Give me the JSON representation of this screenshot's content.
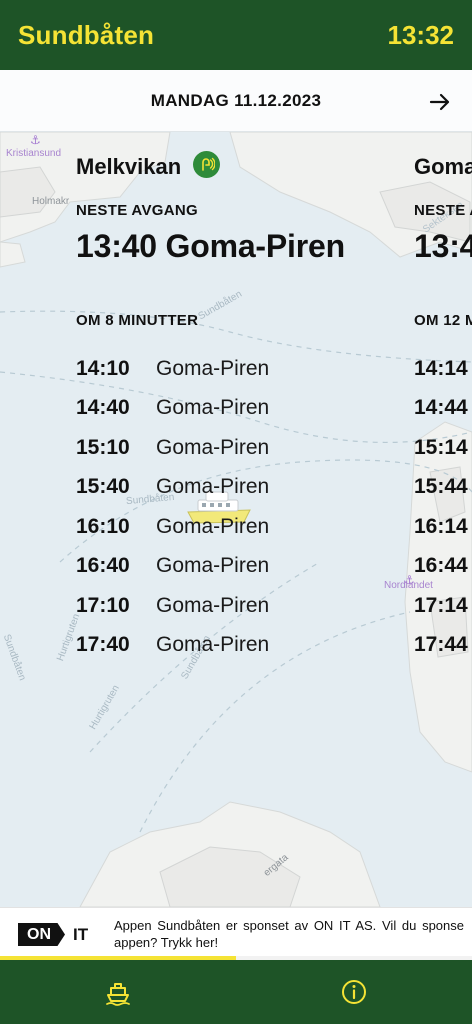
{
  "header": {
    "title": "Sundbåten",
    "time": "13:32"
  },
  "date_bar": {
    "date": "MANDAG 11.12.2023",
    "next_icon": "arrow-right-icon"
  },
  "panels": [
    {
      "stop": "Melkvikan",
      "realtime_icon": "realtime-icon",
      "next_label": "NESTE AVGANG",
      "next_departure": "13:40 Goma-Piren",
      "countdown": "OM 8 MINUTTER",
      "departures": [
        {
          "time": "14:10",
          "dest": "Goma-Piren"
        },
        {
          "time": "14:40",
          "dest": "Goma-Piren"
        },
        {
          "time": "15:10",
          "dest": "Goma-Piren"
        },
        {
          "time": "15:40",
          "dest": "Goma-Piren"
        },
        {
          "time": "16:10",
          "dest": "Goma-Piren"
        },
        {
          "time": "16:40",
          "dest": "Goma-Piren"
        },
        {
          "time": "17:10",
          "dest": "Goma-Piren"
        },
        {
          "time": "17:40",
          "dest": "Goma-Piren"
        }
      ]
    },
    {
      "stop": "Goma",
      "next_label": "NESTE A",
      "next_departure": "13:4",
      "countdown": "OM 12 M",
      "departures": [
        {
          "time": "14:14"
        },
        {
          "time": "14:44"
        },
        {
          "time": "15:14"
        },
        {
          "time": "15:44"
        },
        {
          "time": "16:14"
        },
        {
          "time": "16:44"
        },
        {
          "time": "17:14"
        },
        {
          "time": "17:44"
        }
      ]
    }
  ],
  "map_labels": {
    "kristiansund": "Kristiansund",
    "holmakr": "Holmakr",
    "sundbaten_top": "Sundbåten",
    "sundbaten_mid": "Sundbåten",
    "sundbaten_left": "Sundbåten",
    "hurtigruten_1": "Hurtigruten",
    "hurtigruten_2": "Hurtigruten",
    "sundbaten_low": "Sundbåten",
    "nordlandet": "Nordlandet",
    "gata": "ergata",
    "iteksen": "Sekteksen"
  },
  "sponsor": {
    "logo_on": "ON",
    "logo_it": "IT",
    "text": "Appen Sundbåten er sponset av ON IT AS. Vil du sponse appen? Trykk her!",
    "progress": 0.5
  },
  "bottom_nav": {
    "items": [
      {
        "icon": "ferry-icon"
      },
      {
        "icon": "info-icon"
      }
    ]
  },
  "colors": {
    "brand_green": "#1e5427",
    "accent_yellow": "#f5e335",
    "badge_green": "#2e8b3a",
    "water": "#e4edf2"
  }
}
